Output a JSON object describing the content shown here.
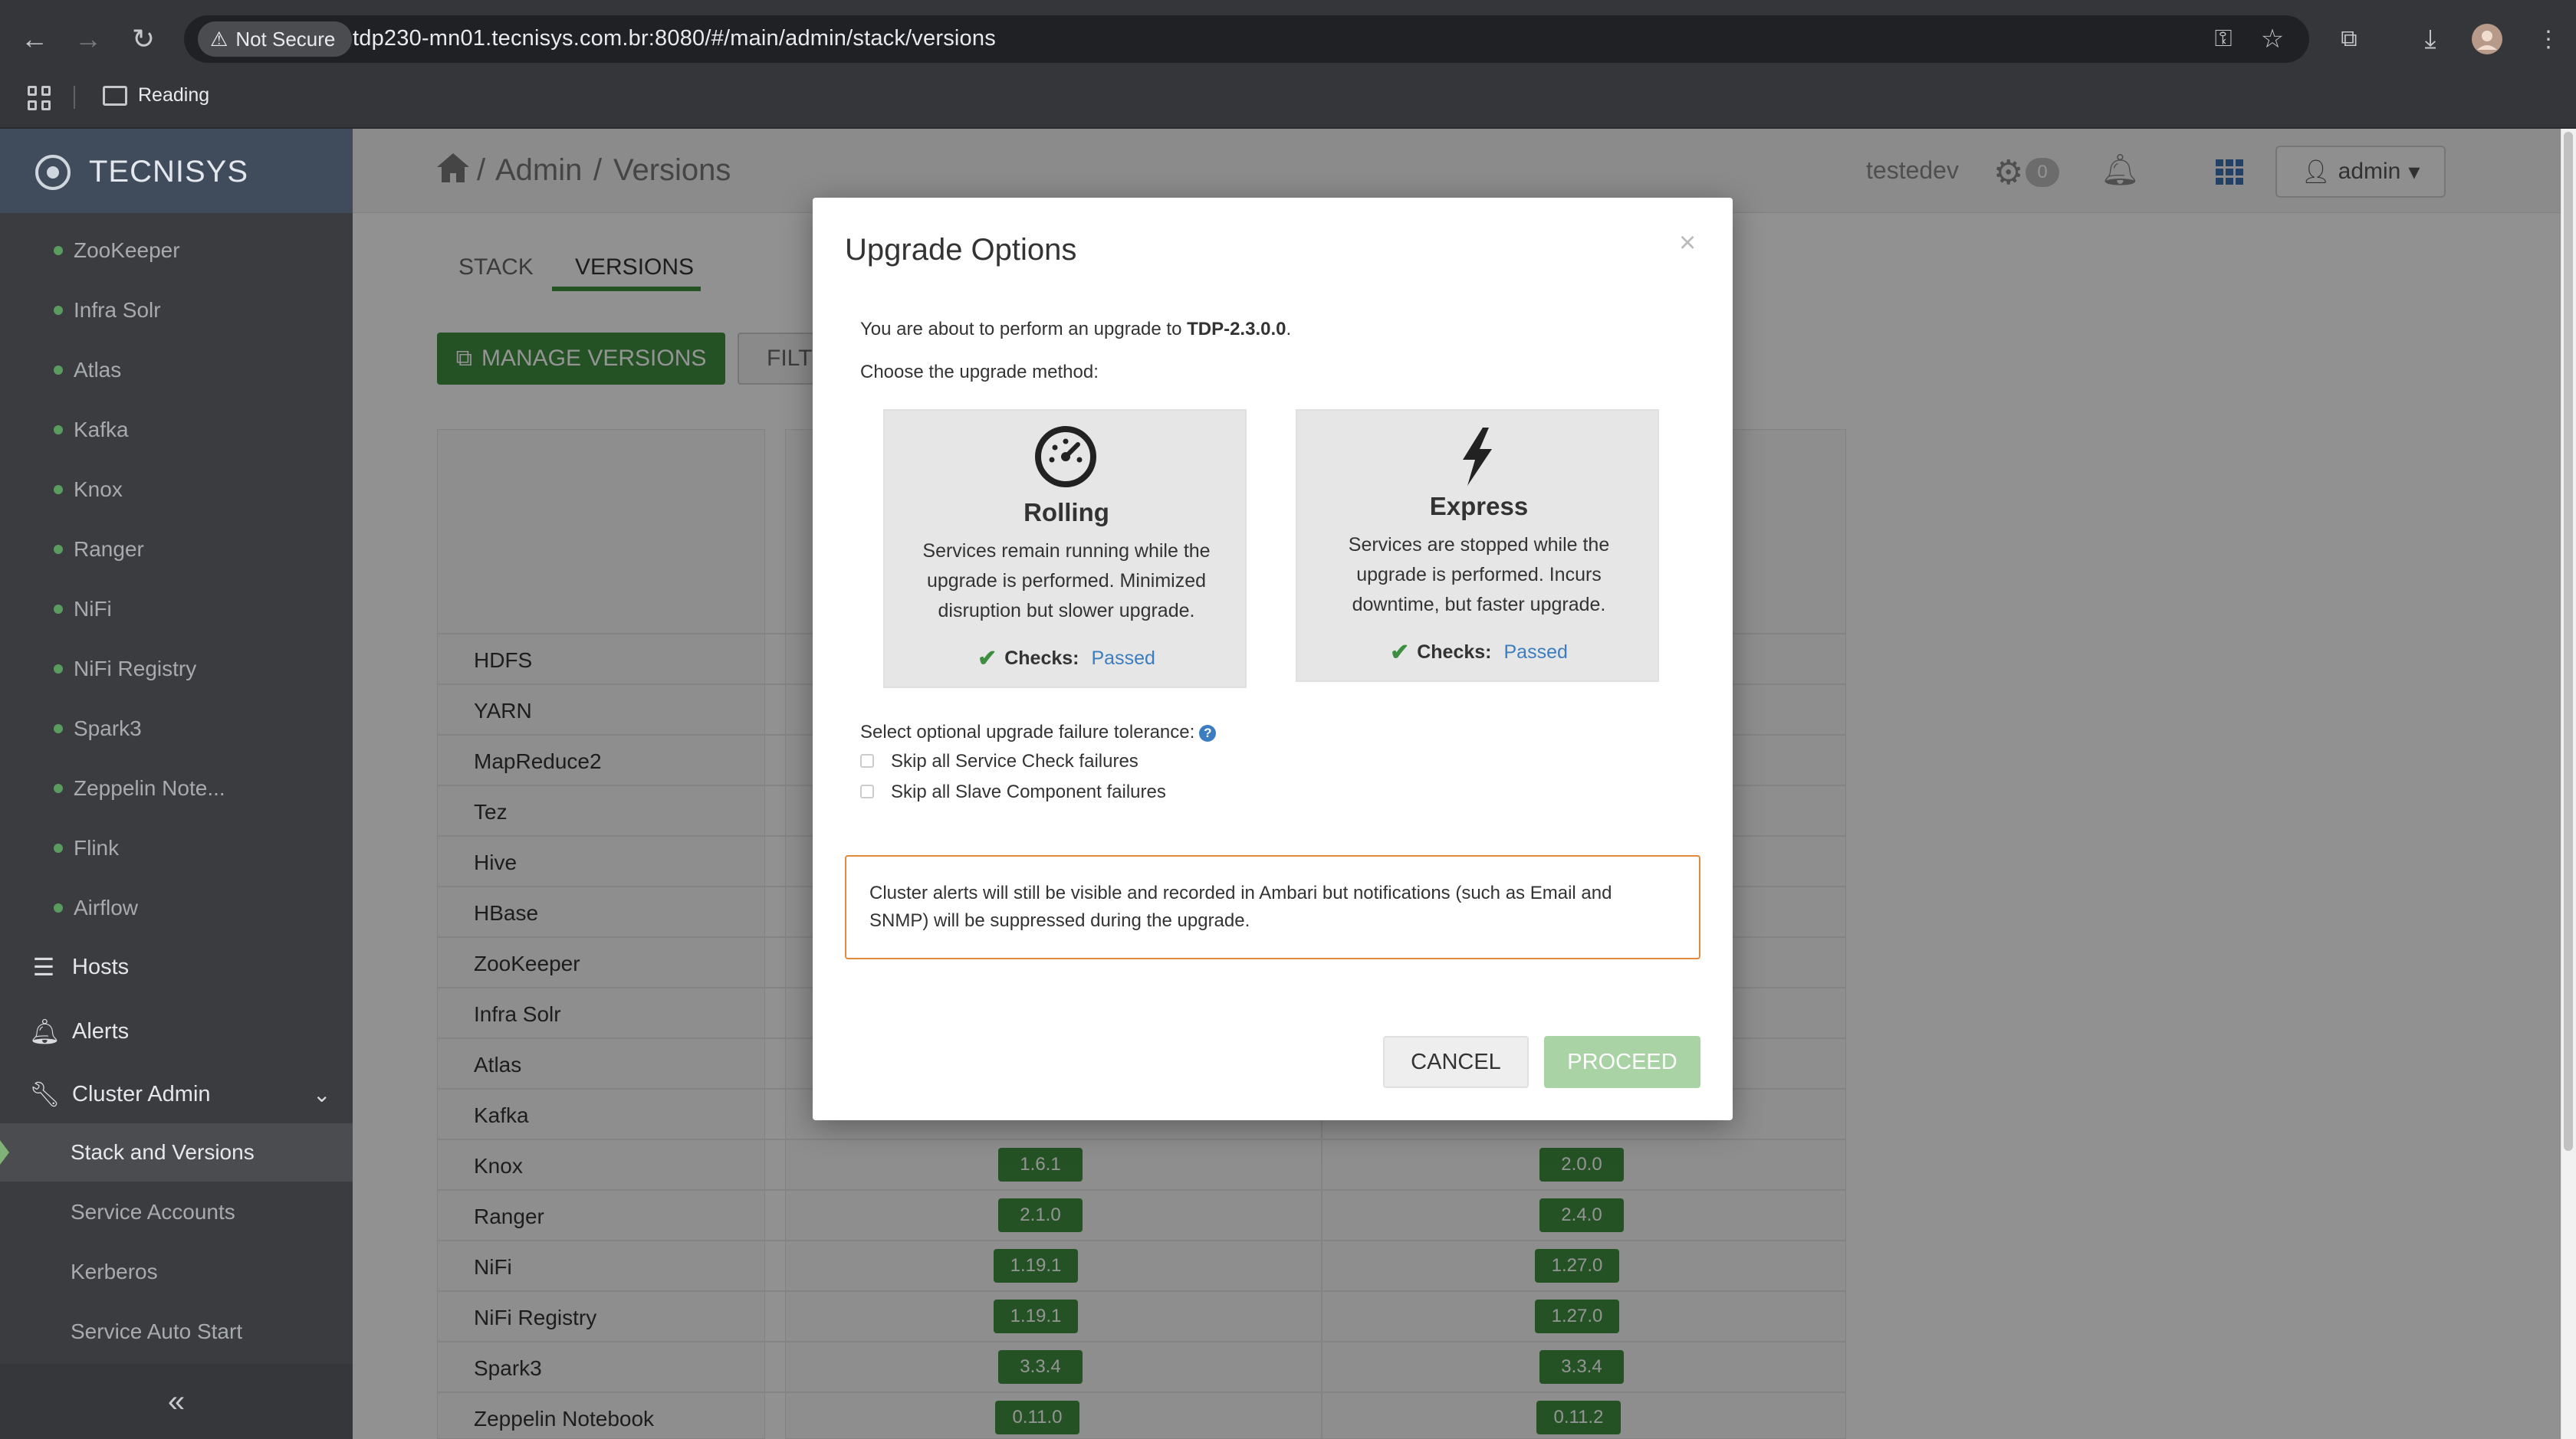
{
  "browser": {
    "security_label": "Not Secure",
    "url": "tdp230-mn01.tecnisys.com.br:8080/#/main/admin/stack/versions",
    "bookmark_folder": "Reading",
    "icons": [
      "back-icon",
      "forward-icon",
      "reload-icon",
      "key-icon",
      "star-icon",
      "extension-icon",
      "download-icon",
      "profile-avatar"
    ]
  },
  "app": {
    "brand": "TECNISYS",
    "breadcrumb": {
      "section": "Admin",
      "separator": "/",
      "page": "Versions"
    },
    "username": "testedev",
    "ops_count": "0",
    "user_menu": "admin"
  },
  "sidebar": {
    "services": [
      "ZooKeeper",
      "Infra Solr",
      "Atlas",
      "Kafka",
      "Knox",
      "Ranger",
      "NiFi",
      "NiFi Registry",
      "Spark3",
      "Zeppelin Note...",
      "Flink",
      "Airflow"
    ],
    "nav": {
      "hosts": "Hosts",
      "alerts": "Alerts",
      "cluster_admin": "Cluster Admin"
    },
    "cluster_admin_items": [
      "Stack and Versions",
      "Service Accounts",
      "Kerberos",
      "Service Auto Start"
    ],
    "active_item": "Stack and Versions",
    "collapse_glyph": "«"
  },
  "page": {
    "tabs": {
      "stack": "STACK",
      "versions": "VERSIONS"
    },
    "active_tab": "VERSIONS",
    "manage_versions": "MANAGE VERSIONS",
    "filter": "FILTER",
    "service_rows": [
      "HDFS",
      "YARN",
      "MapReduce2",
      "Tez",
      "Hive",
      "HBase",
      "ZooKeeper",
      "Infra Solr",
      "Atlas",
      "Kafka",
      "Knox",
      "Ranger",
      "NiFi",
      "NiFi Registry",
      "Spark3",
      "Zeppelin Notebook"
    ],
    "version_rows": [
      {
        "service": "Knox",
        "current": "1.6.1",
        "target": "2.0.0"
      },
      {
        "service": "Ranger",
        "current": "2.1.0",
        "target": "2.4.0"
      },
      {
        "service": "NiFi",
        "current": "1.19.1",
        "target": "1.27.0"
      },
      {
        "service": "NiFi Registry",
        "current": "1.19.1",
        "target": "1.27.0"
      },
      {
        "service": "Spark3",
        "current": "3.3.4",
        "target": "3.3.4"
      },
      {
        "service": "Zeppelin Notebook",
        "current": "0.11.0",
        "target": "0.11.2"
      }
    ]
  },
  "modal": {
    "title": "Upgrade Options",
    "close_glyph": "×",
    "intro_prefix": "You are about to perform an upgrade to ",
    "intro_version": "TDP-2.3.0.0",
    "intro_suffix": ".",
    "choose_text": "Choose the upgrade method:",
    "options": [
      {
        "name": "Rolling",
        "icon": "gauge-icon",
        "description": "Services remain running while the upgrade is performed. Minimized disruption but slower upgrade.",
        "checks_label": "Checks:",
        "checks_status": "Passed"
      },
      {
        "name": "Express",
        "icon": "bolt-icon",
        "description": "Services are stopped while the upgrade is performed. Incurs downtime, but faster upgrade.",
        "checks_label": "Checks:",
        "checks_status": "Passed"
      }
    ],
    "tolerance_label": "Select optional upgrade failure tolerance:",
    "tolerance_options": [
      "Skip all Service Check failures",
      "Skip all Slave Component failures"
    ],
    "alert_text": "Cluster alerts will still be visible and recorded in Ambari but notifications (such as Email and SNMP) will be suppressed during the upgrade.",
    "cancel_label": "CANCEL",
    "proceed_label": "PROCEED"
  },
  "colors": {
    "accent_green": "#3e8e41",
    "proceed_disabled": "#a9d3a4",
    "link_blue": "#3b7dc0",
    "alert_border": "#e08a3c"
  }
}
